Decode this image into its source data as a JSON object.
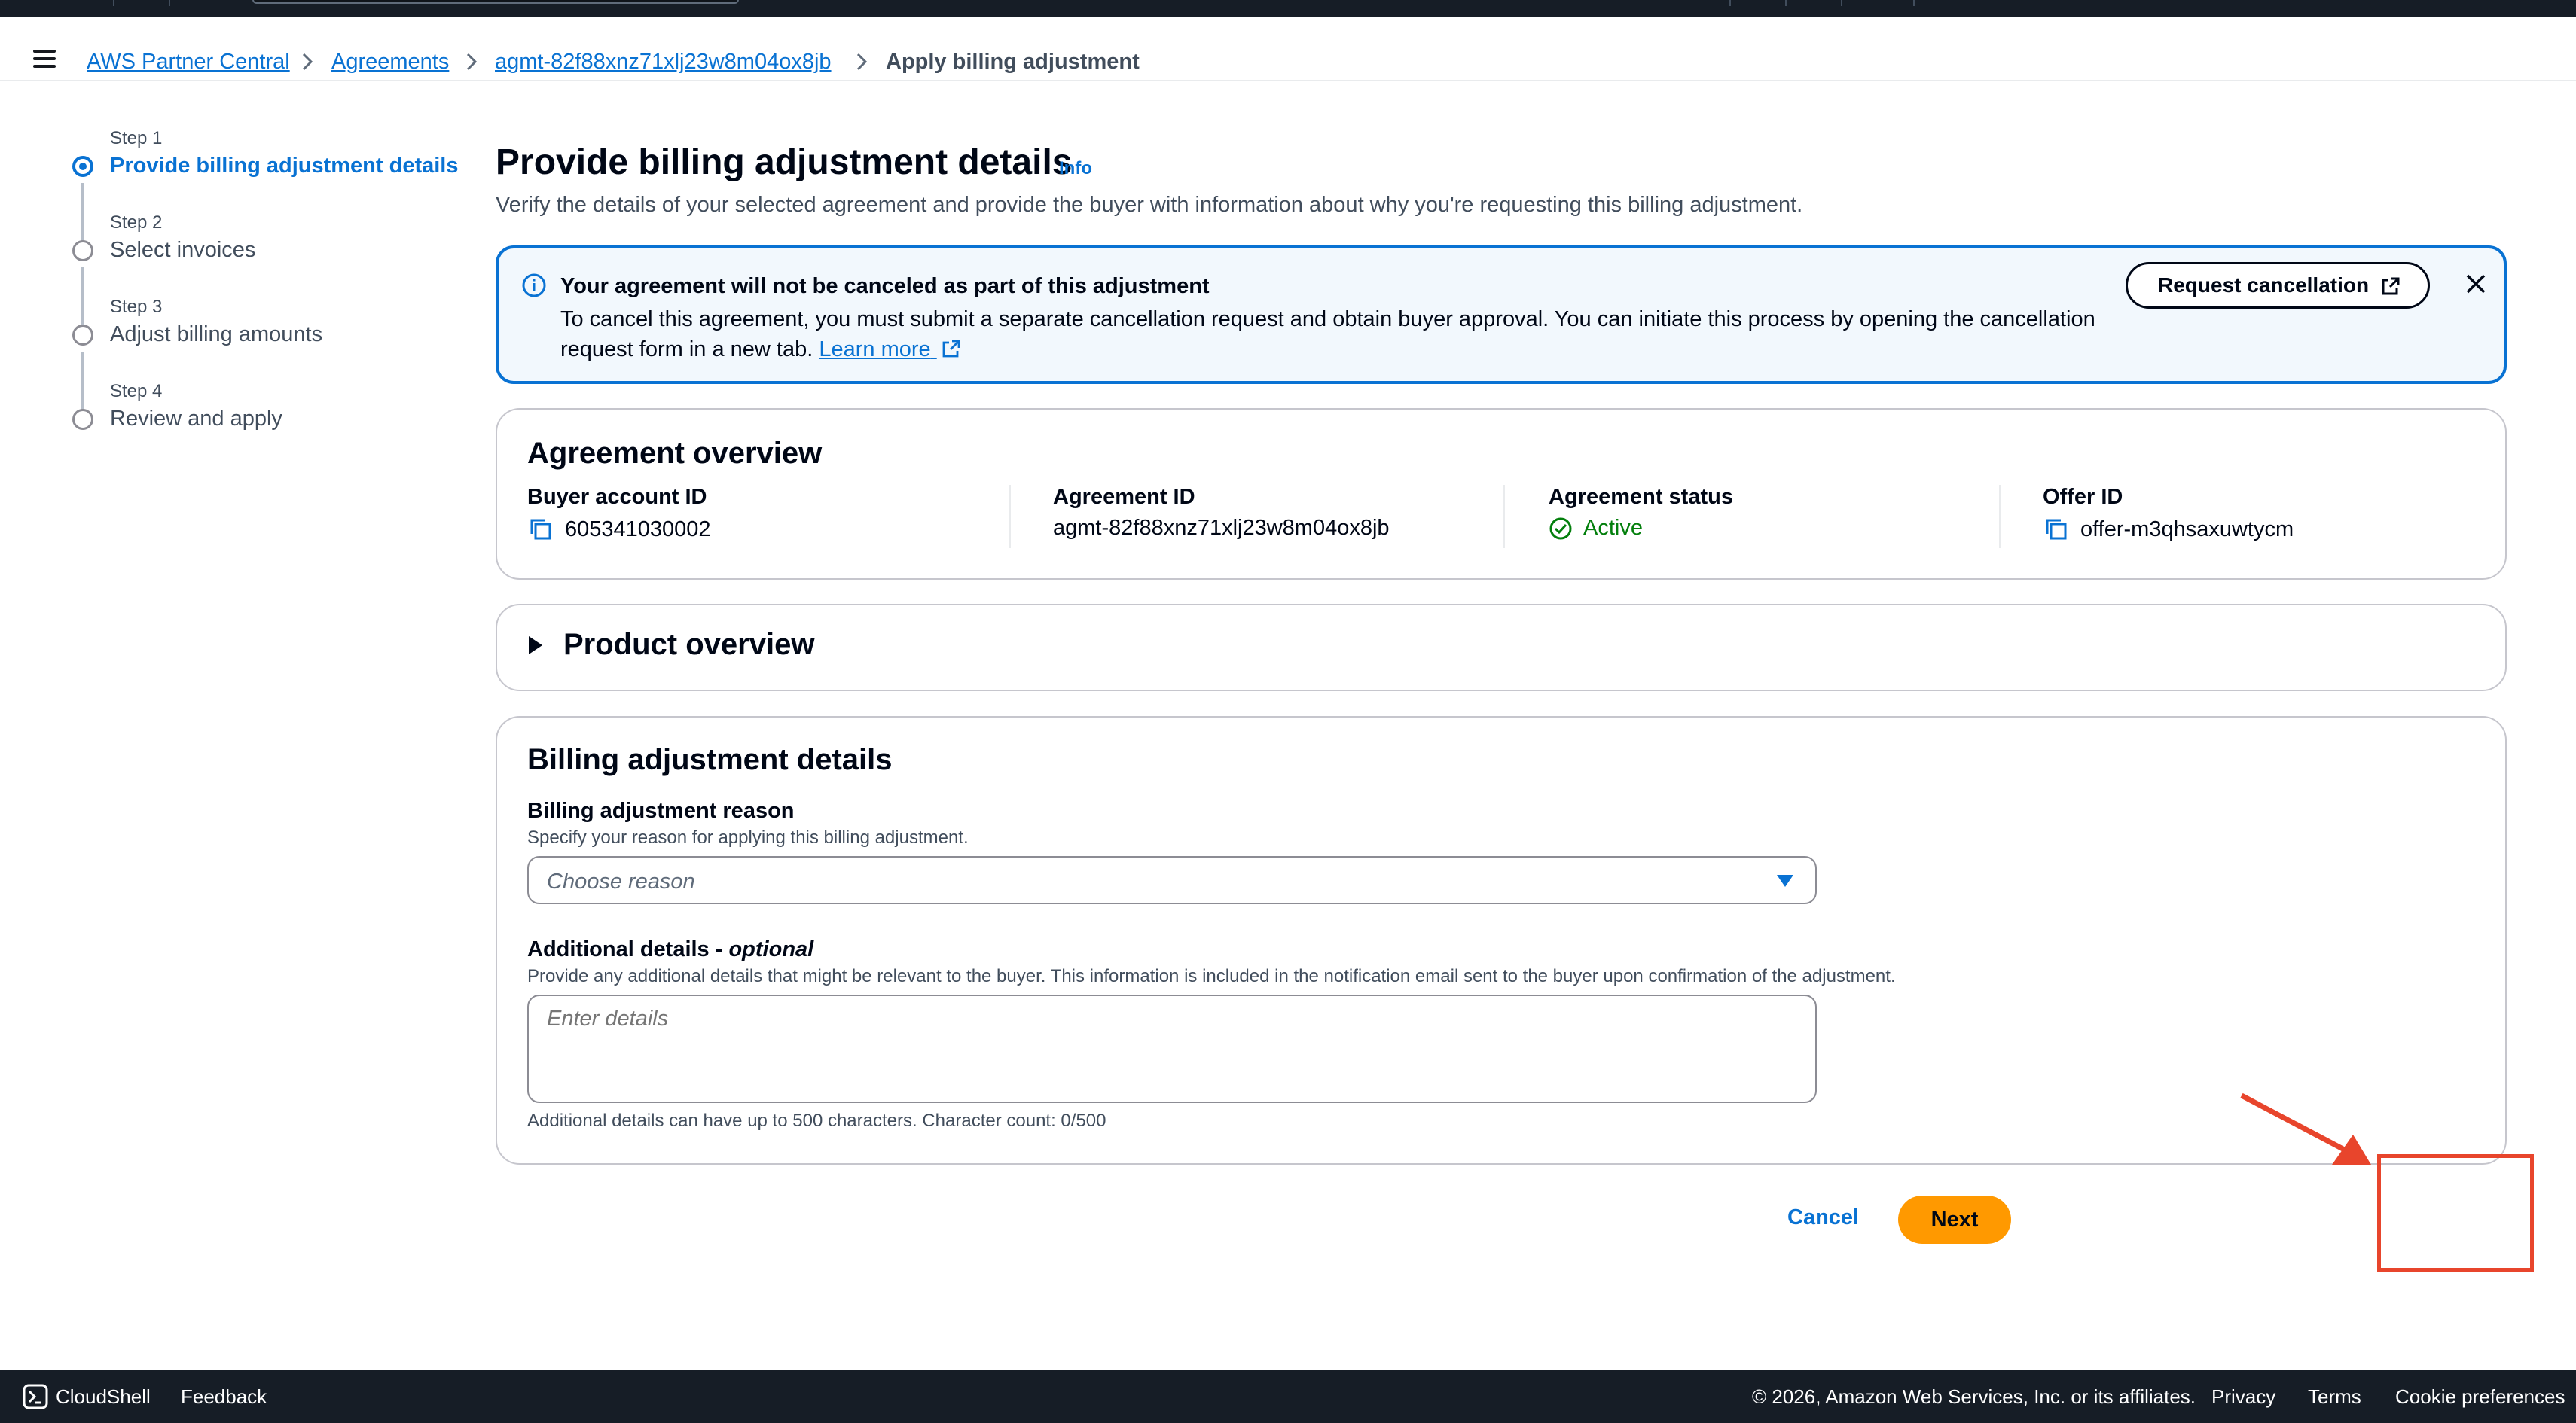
{
  "breadcrumbs": {
    "items": [
      "AWS Partner Central",
      "Agreements",
      "agmt-82f88xnz71xlj23w8m04ox8jb"
    ],
    "current": "Apply billing adjustment"
  },
  "steps": [
    {
      "num": "Step 1",
      "title": "Provide billing adjustment details"
    },
    {
      "num": "Step 2",
      "title": "Select invoices"
    },
    {
      "num": "Step 3",
      "title": "Adjust billing amounts"
    },
    {
      "num": "Step 4",
      "title": "Review and apply"
    }
  ],
  "page": {
    "title": "Provide billing adjustment details",
    "info": "Info",
    "description": "Verify the details of your selected agreement and provide the buyer with information about why you're requesting this billing adjustment."
  },
  "alert": {
    "title": "Your agreement will not be canceled as part of this adjustment",
    "body": "To cancel this agreement, you must submit a separate cancellation request and obtain buyer approval. You can initiate this process by opening the cancellation request form in a new tab.",
    "learn_more": "Learn more",
    "button": "Request cancellation"
  },
  "overview": {
    "title": "Agreement overview",
    "buyer_label": "Buyer account ID",
    "buyer_value": "605341030002",
    "agreement_label": "Agreement ID",
    "agreement_value": "agmt-82f88xnz71xlj23w8m04ox8jb",
    "status_label": "Agreement status",
    "status_value": "Active",
    "offer_label": "Offer ID",
    "offer_value": "offer-m3qhsaxuwtycm"
  },
  "product": {
    "title": "Product overview"
  },
  "billing": {
    "title": "Billing adjustment details",
    "reason_label": "Billing adjustment reason",
    "reason_desc": "Specify your reason for applying this billing adjustment.",
    "reason_placeholder": "Choose reason",
    "details_label": "Additional details - ",
    "details_optional": "optional",
    "details_desc": "Provide any additional details that might be relevant to the buyer. This information is included in the notification email sent to the buyer upon confirmation of the adjustment.",
    "details_placeholder": "Enter details",
    "details_constraint": "Additional details can have up to 500 characters. Character count: 0/500"
  },
  "actions": {
    "cancel": "Cancel",
    "next": "Next"
  },
  "footer": {
    "cloudshell": "CloudShell",
    "feedback": "Feedback",
    "copyright": "© 2026, Amazon Web Services, Inc. or its affiliates.",
    "privacy": "Privacy",
    "terms": "Terms",
    "cookies": "Cookie preferences"
  },
  "colors": {
    "accent": "#0972d3",
    "primary_button": "#ff9900",
    "success": "#037f0c",
    "annotation": "#e8452c"
  }
}
